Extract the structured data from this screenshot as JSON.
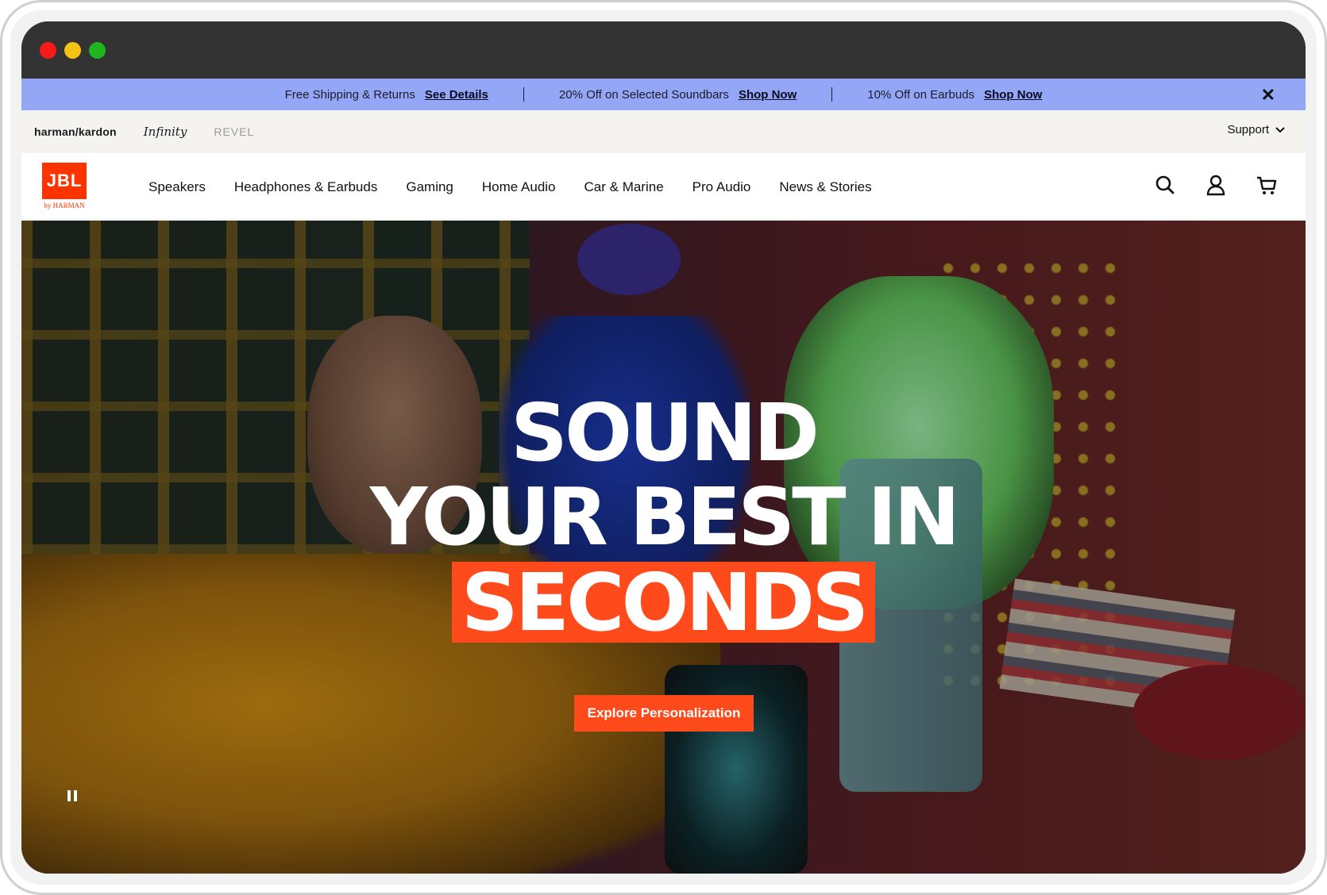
{
  "promo": {
    "items": [
      {
        "text": "Free Shipping & Returns",
        "link": "See Details"
      },
      {
        "text": "20% Off on Selected Soundbars",
        "link": "Shop Now"
      },
      {
        "text": "10% Off on Earbuds",
        "link": "Shop Now"
      }
    ],
    "close_label": "✕"
  },
  "brands": {
    "harman_kardon": "harman/kardon",
    "infinity": "Infinity",
    "revel": "REVEL",
    "support": "Support"
  },
  "nav": {
    "logo_text": "JBL",
    "logo_sub": "by HARMAN",
    "items": [
      "Speakers",
      "Headphones & Earbuds",
      "Gaming",
      "Home Audio",
      "Car & Marine",
      "Pro Audio",
      "News & Stories"
    ],
    "icons": [
      "search-icon",
      "account-icon",
      "cart-icon"
    ]
  },
  "hero": {
    "line1": "SOUND",
    "line2": "YOUR BEST IN",
    "line3": "SECONDS",
    "cta": "Explore Personalization"
  },
  "colors": {
    "promo_bg": "#94a7f7",
    "accent": "#ff4a1c",
    "brandbar_bg": "#f5f3ef"
  }
}
